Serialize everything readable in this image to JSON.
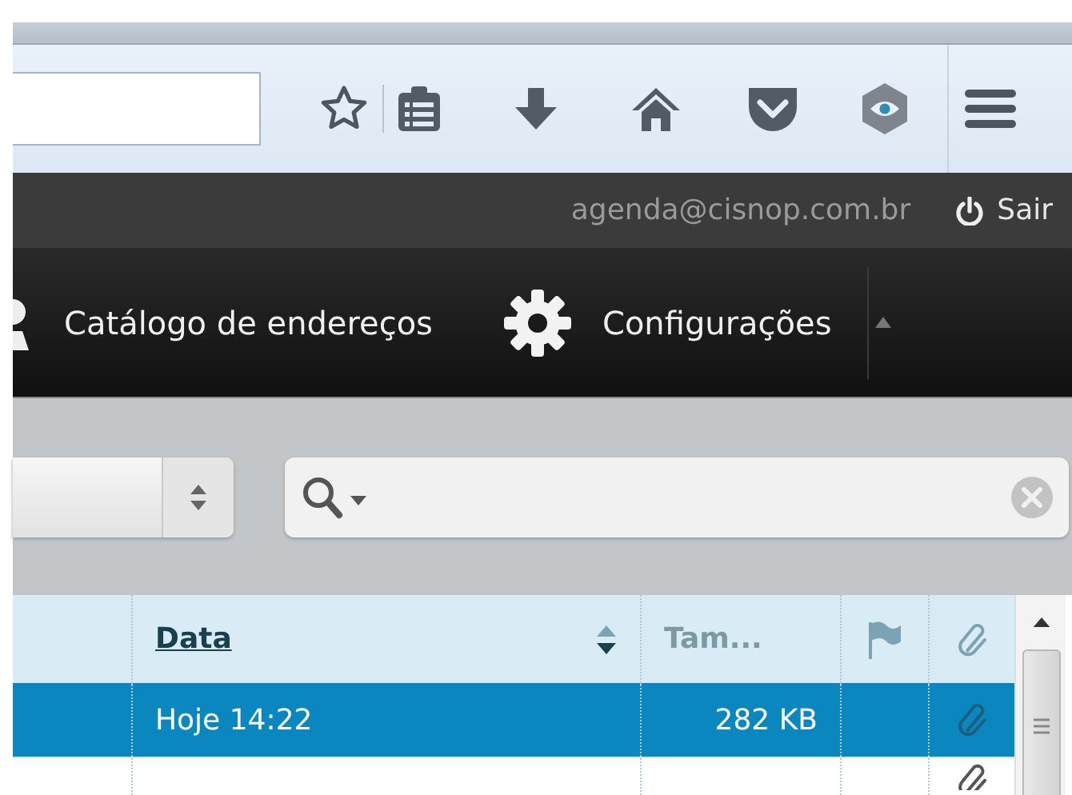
{
  "user_bar": {
    "email": "agenda@cisnop.com.br",
    "logout": "Sair"
  },
  "nav": [
    {
      "kind": "contacts",
      "label": "Catálogo de endereços"
    },
    {
      "kind": "settings",
      "label": "Configurações"
    }
  ],
  "message_list": {
    "columns": [
      {
        "kind": "subject"
      },
      {
        "kind": "date",
        "label": "Data",
        "sorted": true
      },
      {
        "kind": "size",
        "label": "Tam...",
        "sorted": false
      },
      {
        "kind": "flag"
      },
      {
        "kind": "attachment"
      }
    ],
    "rows": [
      {
        "selected": true,
        "date": "Hoje 14:22",
        "size": "282 KB",
        "attachment": true
      },
      {
        "selected": false,
        "attachment": true
      }
    ]
  }
}
